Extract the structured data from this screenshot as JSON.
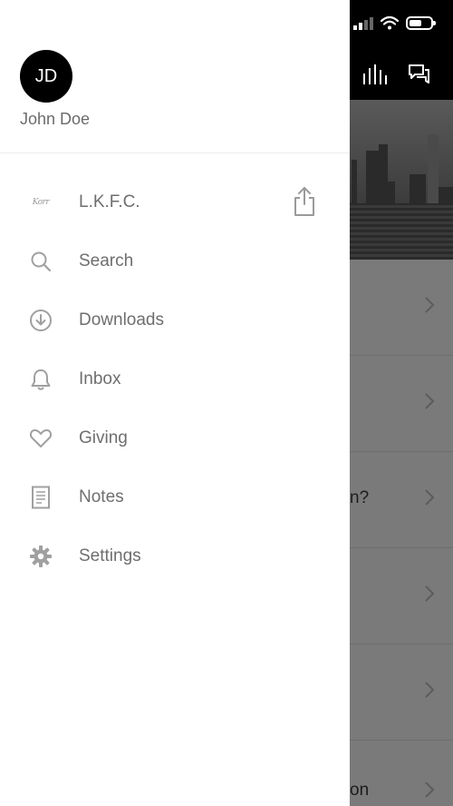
{
  "profile": {
    "initials": "JD",
    "name": "John Doe"
  },
  "menu": [
    {
      "key": "lkfc",
      "label": "L.K.F.C.",
      "icon": "church-logo-icon"
    },
    {
      "key": "search",
      "label": "Search",
      "icon": "search-icon"
    },
    {
      "key": "downloads",
      "label": "Downloads",
      "icon": "download-icon"
    },
    {
      "key": "inbox",
      "label": "Inbox",
      "icon": "bell-icon"
    },
    {
      "key": "giving",
      "label": "Giving",
      "icon": "heart-icon"
    },
    {
      "key": "notes",
      "label": "Notes",
      "icon": "notes-icon"
    },
    {
      "key": "settings",
      "label": "Settings",
      "icon": "gear-icon"
    }
  ],
  "brand_logo_text": "Korr",
  "background": {
    "rows": [
      {
        "text": ""
      },
      {
        "text": ""
      },
      {
        "text": "n?"
      },
      {
        "text": ""
      },
      {
        "text": ""
      },
      {
        "text": "on"
      }
    ]
  },
  "colors": {
    "drawer_bg": "#ffffff",
    "text": "#6e6e6e",
    "avatar_bg": "#000000",
    "overlay": "#7a7a7a"
  }
}
